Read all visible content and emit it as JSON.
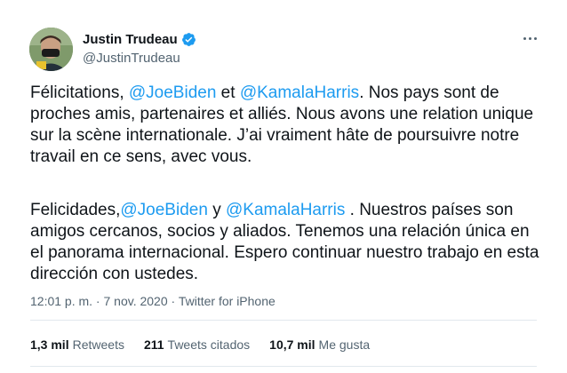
{
  "author": {
    "name": "Justin Trudeau",
    "handle": "@JustinTrudeau"
  },
  "tweet": {
    "paragraph1": [
      {
        "text": "Félicitations, ",
        "mention": false
      },
      {
        "text": "@JoeBiden",
        "mention": true
      },
      {
        "text": " et ",
        "mention": false
      },
      {
        "text": "@KamalaHarris",
        "mention": true
      },
      {
        "text": ". Nos pays sont de proches amis, partenaires et alliés. Nous avons une relation unique sur la scène internationale. J’ai vraiment hâte de poursuivre notre travail en ce sens, avec vous.",
        "mention": false
      }
    ],
    "paragraph2": [
      {
        "text": "Felicidades,",
        "mention": false
      },
      {
        "text": "@JoeBiden",
        "mention": true
      },
      {
        "text": " y ",
        "mention": false
      },
      {
        "text": "@KamalaHarris",
        "mention": true
      },
      {
        "text": " . Nuestros países son amigos cercanos, socios y aliados. Tenemos una relación única en el panorama internacional. Espero continuar nuestro trabajo en esta dirección con ustedes.",
        "mention": false
      }
    ]
  },
  "meta": {
    "time": "12:01 p. m.",
    "separator": " · ",
    "date": "7 nov. 2020",
    "source": "Twitter for iPhone"
  },
  "stats": {
    "retweets_count": "1,3 mil",
    "retweets_label": "Retweets",
    "quotes_count": "211",
    "quotes_label": "Tweets citados",
    "likes_count": "10,7 mil",
    "likes_label": "Me gusta"
  },
  "colors": {
    "mention": "#1d9bf0",
    "secondary_text": "#536471",
    "verified": "#1d9bf0"
  },
  "icons": {
    "verified": "verified-badge-icon",
    "more": "more-options-icon"
  }
}
